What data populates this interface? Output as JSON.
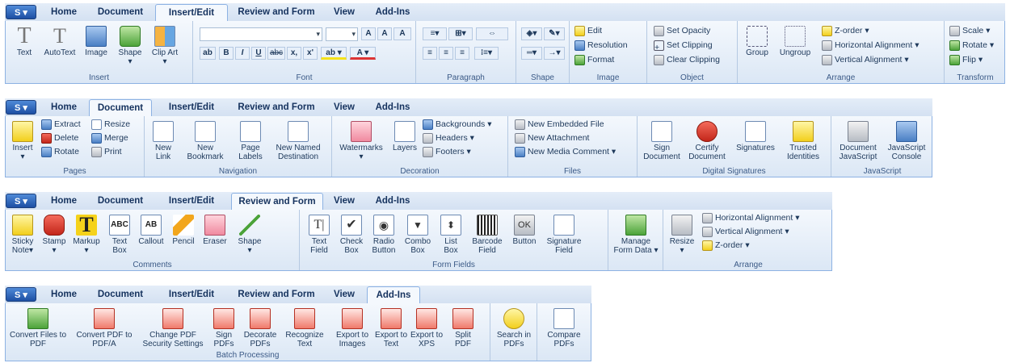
{
  "app_button": "S ▾",
  "ribbon1": {
    "tabs": [
      "Home",
      "Document",
      "Insert/Edit",
      "Review and Form",
      "View",
      "Add-Ins"
    ],
    "insert": {
      "label": "Insert",
      "items": [
        "Text",
        "AutoText",
        "Image",
        "Shape",
        "Clip Art"
      ]
    },
    "font": {
      "label": "Font",
      "bold": "B",
      "italic": "I",
      "underline": "U",
      "strike": "abc",
      "sub": "x,",
      "sup": "x'"
    },
    "paragraph": {
      "label": "Paragraph"
    },
    "shape": {
      "label": "Shape"
    },
    "image": {
      "label": "Image",
      "items": [
        "Edit",
        "Resolution",
        "Format"
      ]
    },
    "object": {
      "label": "Object",
      "items": [
        "Set Opacity",
        "Set Clipping",
        "Clear Clipping"
      ]
    },
    "arrange": {
      "label": "Arrange",
      "group": "Group",
      "ungroup": "Ungroup",
      "items": [
        "Z-order ▾",
        "Horizontal Alignment ▾",
        "Vertical Alignment ▾"
      ]
    },
    "transform": {
      "label": "Transform",
      "items": [
        "Scale ▾",
        "Rotate ▾",
        "Flip ▾"
      ]
    }
  },
  "ribbon2": {
    "tabs": [
      "Home",
      "Document",
      "Insert/Edit",
      "Review and Form",
      "View",
      "Add-Ins"
    ],
    "pages": {
      "label": "Pages",
      "insert": "Insert",
      "items": [
        "Extract",
        "Delete",
        "Rotate",
        "Resize",
        "Merge",
        "Print"
      ]
    },
    "navigation": {
      "label": "Navigation",
      "items": [
        "New Link",
        "New Bookmark",
        "Page Labels",
        "New Named Destination"
      ]
    },
    "decoration": {
      "label": "Decoration",
      "watermarks": "Watermarks",
      "layers": "Layers",
      "items": [
        "Backgrounds ▾",
        "Headers ▾",
        "Footers ▾"
      ]
    },
    "files": {
      "label": "Files",
      "items": [
        "New Embedded File",
        "New Attachment",
        "New Media Comment ▾"
      ]
    },
    "digital": {
      "label": "Digital Signatures",
      "items": [
        "Sign Document",
        "Certify Document",
        "Signatures",
        "Trusted Identities"
      ]
    },
    "javascript": {
      "label": "JavaScript",
      "items": [
        "Document JavaScript",
        "JavaScript Console"
      ]
    }
  },
  "ribbon3": {
    "tabs": [
      "Home",
      "Document",
      "Insert/Edit",
      "Review and Form",
      "View",
      "Add-Ins"
    ],
    "comments": {
      "label": "Comments",
      "items": [
        "Sticky Note",
        "Stamp",
        "Markup",
        "Text Box",
        "Callout",
        "Pencil",
        "Eraser",
        "Shape"
      ],
      "abc": "ABC",
      "ab": "AB"
    },
    "formfields": {
      "label": "Form Fields",
      "items": [
        "Text Field",
        "Check Box",
        "Radio Button",
        "Combo Box",
        "List Box",
        "Barcode Field",
        "Button",
        "Signature Field"
      ],
      "ok": "OK"
    },
    "manage": {
      "label": "Manage Form Data ▾"
    },
    "arrange": {
      "label": "Arrange",
      "resize": "Resize",
      "items": [
        "Horizontal Alignment ▾",
        "Vertical Alignment ▾",
        "Z-order ▾"
      ]
    }
  },
  "ribbon4": {
    "tabs": [
      "Home",
      "Document",
      "Insert/Edit",
      "Review and Form",
      "View",
      "Add-Ins"
    ],
    "batch": {
      "label": "Batch Processing",
      "items": [
        "Convert Files to PDF",
        "Convert PDF to PDF/A",
        "Change PDF Security Settings",
        "Sign PDFs",
        "Decorate PDFs",
        "Recognize Text",
        "Export to Images",
        "Export to Text",
        "Export to XPS",
        "Split PDF"
      ]
    },
    "search": "Search in PDFs",
    "compare": "Compare PDFs"
  }
}
